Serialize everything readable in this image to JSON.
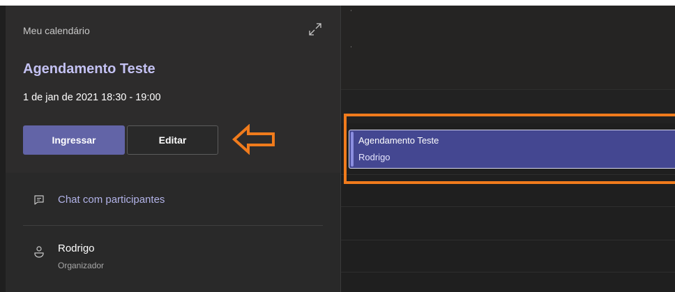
{
  "panel": {
    "calendar_name": "Meu calendário",
    "title": "Agendamento Teste",
    "datetime": "1 de jan de 2021 18:30 - 19:00",
    "join_label": "Ingressar",
    "edit_label": "Editar",
    "chat_label": "Chat com participantes",
    "organizer_name": "Rodrigo",
    "organizer_role": "Organizador"
  },
  "event": {
    "title": "Agendamento Teste",
    "organizer": "Rodrigo"
  },
  "colors": {
    "accent": "#6264a7",
    "title": "#c4c2f3",
    "annotation": "#f07b1c",
    "event_fill": "#444791"
  },
  "icons": {
    "expand": "expand-icon",
    "annotation": "arrow-left-icon",
    "chat": "chat-icon",
    "person": "person-icon"
  }
}
